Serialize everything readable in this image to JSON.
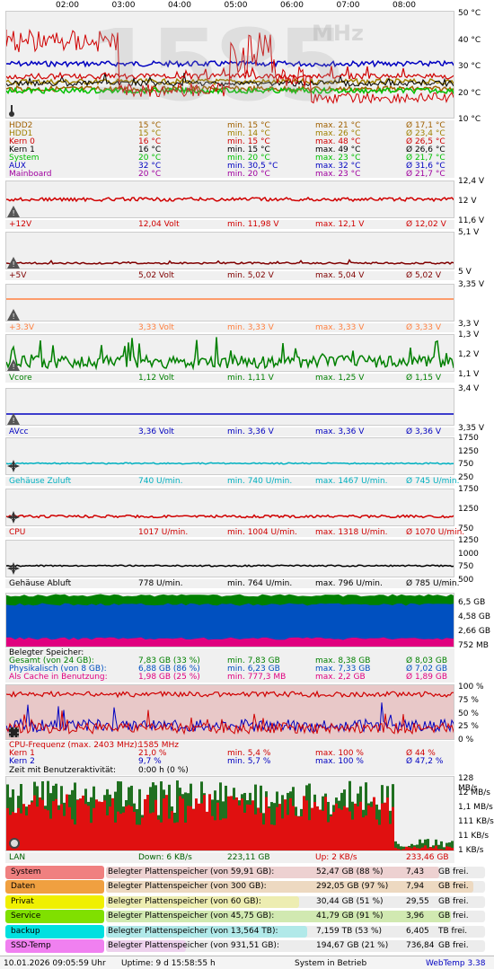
{
  "timeline": [
    "02:00",
    "03:00",
    "04:00",
    "05:00",
    "06:00",
    "07:00",
    "08:00"
  ],
  "temp_scale": [
    "50 °C",
    "40 °C",
    "30 °C",
    "20 °C",
    "10 °C"
  ],
  "watermark": {
    "freq": "1585",
    "unit": "MHz"
  },
  "temps": [
    {
      "name": "HDD2",
      "cur": "15 °C",
      "min": "min. 15 °C",
      "max": "max. 21 °C",
      "avg": "Ø 17,1 °C",
      "color": "#a06000"
    },
    {
      "name": "HDD1",
      "cur": "15 °C",
      "min": "min. 14 °C",
      "max": "max. 26 °C",
      "avg": "Ø 23,4 °C",
      "color": "#a08000"
    },
    {
      "name": "Kern 0",
      "cur": "16 °C",
      "min": "min. 15 °C",
      "max": "max. 48 °C",
      "avg": "Ø 26,5 °C",
      "color": "#d00000"
    },
    {
      "name": "Kern 1",
      "cur": "16 °C",
      "min": "min. 15 °C",
      "max": "max. 49 °C",
      "avg": "Ø 26,6 °C",
      "color": "#000000"
    },
    {
      "name": "System",
      "cur": "20 °C",
      "min": "min. 20 °C",
      "max": "max. 23 °C",
      "avg": "Ø 21,7 °C",
      "color": "#00c000"
    },
    {
      "name": "AUX",
      "cur": "32 °C",
      "min": "min. 30,5 °C",
      "max": "max. 32 °C",
      "avg": "Ø 31,6 °C",
      "color": "#0000c0"
    },
    {
      "name": "Mainboard",
      "cur": "20 °C",
      "min": "min. 20 °C",
      "max": "max. 23 °C",
      "avg": "Ø 21,7 °C",
      "color": "#a000a0"
    }
  ],
  "volts": [
    {
      "name": "+12V",
      "cur": "12,04 Volt",
      "min": "min. 11,98 V",
      "max": "max. 12,1 V",
      "avg": "Ø 12,02 V",
      "color": "#d00000",
      "scale": [
        "12,4 V",
        "12 V",
        "11,6 V"
      ]
    },
    {
      "name": "+5V",
      "cur": "5,02 Volt",
      "min": "min. 5,02 V",
      "max": "max. 5,04 V",
      "avg": "Ø 5,02 V",
      "color": "#800000",
      "scale": [
        "5,1 V",
        "",
        "5 V"
      ]
    },
    {
      "name": "+3.3V",
      "cur": "3,33 Volt",
      "min": "min. 3,33 V",
      "max": "max. 3,33 V",
      "avg": "Ø 3,33 V",
      "color": "#ff8040",
      "scale": [
        "3,35 V",
        "",
        "3,3 V"
      ]
    },
    {
      "name": "Vcore",
      "cur": "1,12 Volt",
      "min": "min. 1,11 V",
      "max": "max. 1,25 V",
      "avg": "Ø 1,15 V",
      "color": "#008000",
      "scale": [
        "1,3 V",
        "1,2 V",
        "1,1 V"
      ]
    },
    {
      "name": "AVcc",
      "cur": "3,36 Volt",
      "min": "min. 3,36 V",
      "max": "max. 3,36 V",
      "avg": "Ø 3,36 V",
      "color": "#0000c0",
      "scale": [
        "3,4 V",
        "",
        "3,35 V"
      ]
    }
  ],
  "fans": [
    {
      "name": "Gehäuse Zuluft",
      "cur": "740 U/min.",
      "min": "min. 740 U/min.",
      "max": "max. 1467 U/min.",
      "avg": "Ø 745 U/min.",
      "color": "#00b0c0",
      "scale": [
        "1750",
        "1250",
        "750",
        "250"
      ]
    },
    {
      "name": "CPU",
      "cur": "1017 U/min.",
      "min": "min. 1004 U/min.",
      "max": "max. 1318 U/min.",
      "avg": "Ø 1070 U/min.",
      "color": "#d00000",
      "scale": [
        "1750",
        "1250",
        "750"
      ]
    },
    {
      "name": "Gehäuse Abluft",
      "cur": "778 U/min.",
      "min": "min. 764 U/min.",
      "max": "max. 796 U/min.",
      "avg": "Ø 785 U/min.",
      "color": "#000000",
      "scale": [
        "1250",
        "1000",
        "750",
        "500"
      ]
    }
  ],
  "memory": {
    "title": "Belegter Speicher:",
    "scale": [
      "6,5 GB",
      "4,58 GB",
      "2,66 GB",
      "752 MB"
    ],
    "rows": [
      {
        "name": "Gesamt (von 24 GB):",
        "cur": "7,83 GB (33 %)",
        "min": "min. 7,83 GB",
        "max": "max. 8,38 GB",
        "avg": "Ø 8,03 GB",
        "color": "#008000"
      },
      {
        "name": "Physikalisch (von 8 GB):",
        "cur": "6,88 GB (86 %)",
        "min": "min. 6,23 GB",
        "max": "max. 7,33 GB",
        "avg": "Ø 7,02 GB",
        "color": "#0050c0"
      },
      {
        "name": "Als Cache in Benutzung:",
        "cur": "1,98 GB (25 %)",
        "min": "min. 777,3 MB",
        "max": "max. 2,2 GB",
        "avg": "Ø 1,89 GB",
        "color": "#e0007f"
      }
    ]
  },
  "cpu": {
    "title": "CPU-Frequenz (max. 2403 MHz):",
    "freq": "1585 MHz",
    "scale": [
      "100 %",
      "75 %",
      "50 %",
      "25 %",
      "0 %"
    ],
    "rows": [
      {
        "name": "Kern 1",
        "cur": "21,0 %",
        "min": "min. 5,4 %",
        "max": "max. 100 %",
        "avg": "Ø 44 %",
        "color": "#d00000"
      },
      {
        "name": "Kern 2",
        "cur": "9,7 %",
        "min": "min. 5,7 %",
        "max": "max. 100 %",
        "avg": "Ø 47,2 %",
        "color": "#0000c0"
      }
    ],
    "idle_label": "Zeit mit Benutzeraktivität:",
    "idle_value": "0:00 h (0 %)"
  },
  "net": {
    "scale": [
      "128 MB/s",
      "12 MB/s",
      "1,1 MB/s",
      "111 KB/s",
      "11 KB/s",
      "1 KB/s"
    ],
    "name": "LAN",
    "down": "Down: 6 KB/s",
    "down_total": "223,11 GB",
    "up": "Up: 2 KB/s",
    "up_total": "233,46 GB"
  },
  "drives": [
    {
      "name": "System",
      "label": "Belegter Plattenspeicher (von 59,91 GB):",
      "used": "52,47 GB (88 %)",
      "free_val": "7,43",
      "free_unit": "GB frei.",
      "color": "#f08080",
      "pct": 0.88
    },
    {
      "name": "Daten",
      "label": "Belegter Plattenspeicher (von 300 GB):",
      "used": "292,05 GB (97 %)",
      "free_val": "7,94",
      "free_unit": "GB frei.",
      "color": "#f0a040",
      "pct": 0.97
    },
    {
      "name": "Privat",
      "label": "Belegter Plattenspeicher (von 60 GB):",
      "used": "30,44 GB (51 %)",
      "free_val": "29,55",
      "free_unit": "GB frei.",
      "color": "#f0f000",
      "pct": 0.51
    },
    {
      "name": "Service",
      "label": "Belegter Plattenspeicher (von 45,75 GB):",
      "used": "41,79 GB (91 %)",
      "free_val": "3,96",
      "free_unit": "GB frei.",
      "color": "#80e000",
      "pct": 0.91
    },
    {
      "name": "backup",
      "label": "Belegter Plattenspeicher (von 13,564 TB):",
      "used": "7,159 TB (53 %)",
      "free_val": "6,405",
      "free_unit": "TB frei.",
      "color": "#00e0e0",
      "pct": 0.53
    },
    {
      "name": "SSD-Temp",
      "label": "Belegter Plattenspeicher (von 931,51 GB):",
      "used": "194,67 GB (21 %)",
      "free_val": "736,84",
      "free_unit": "GB frei.",
      "color": "#f080f0",
      "pct": 0.21
    }
  ],
  "footer": {
    "datetime": "10.01.2026 09:05:59 Uhr",
    "uptime": "Uptime: 9 d 15:58:55 h",
    "status": "System in Betrieb",
    "app": "WebTemp 3.38"
  }
}
